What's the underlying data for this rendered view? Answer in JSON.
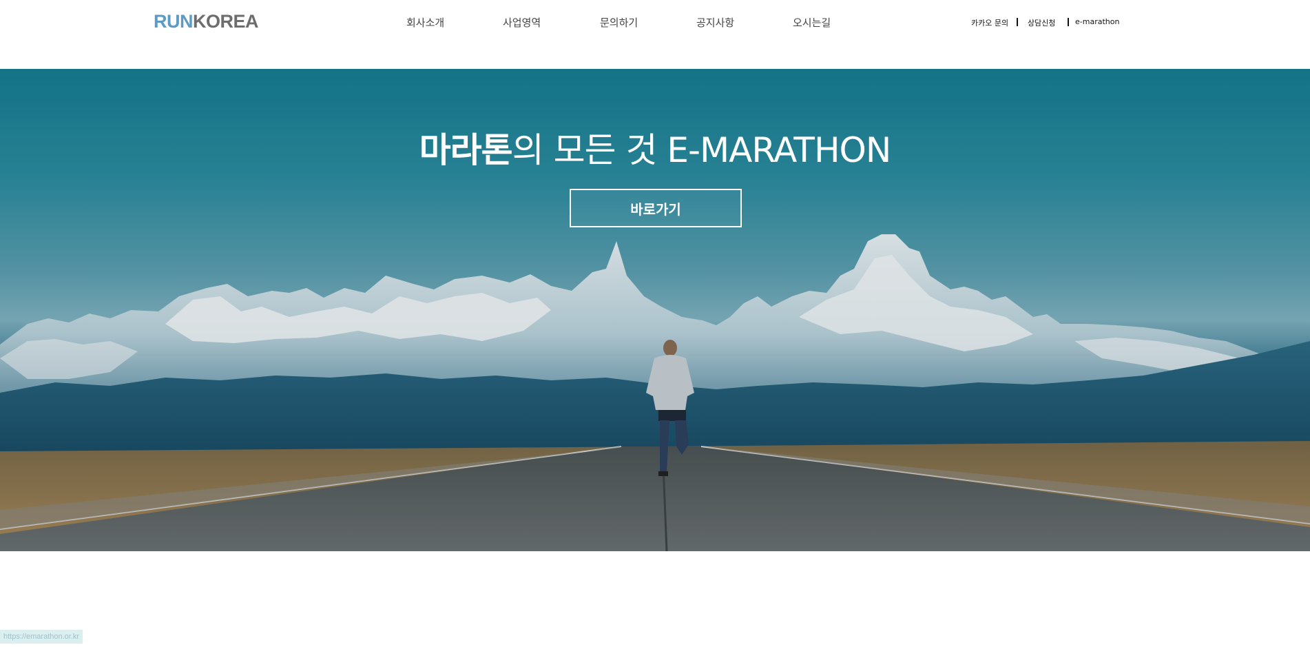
{
  "header": {
    "logo": {
      "part1": "RUN",
      "part2": "KOREA"
    },
    "nav": [
      {
        "label": "회사소개"
      },
      {
        "label": "사업영역"
      },
      {
        "label": "문의하기"
      },
      {
        "label": "공지사항"
      },
      {
        "label": "오시는길"
      }
    ],
    "util_links": [
      {
        "label": "카카오 문의"
      },
      {
        "label": "상담신청"
      },
      {
        "label": "e-marathon"
      }
    ]
  },
  "hero": {
    "title_bold": "마라톤",
    "title_light": "의 모든 것",
    "title_en": "E-MARATHON",
    "button_label": "바로가기"
  },
  "status_bar": {
    "url": "https://emarathon.or.kr"
  },
  "colors": {
    "logo_run": "#5b9bc4",
    "logo_korea": "#6d6d6d",
    "sky": "#1e8497"
  }
}
